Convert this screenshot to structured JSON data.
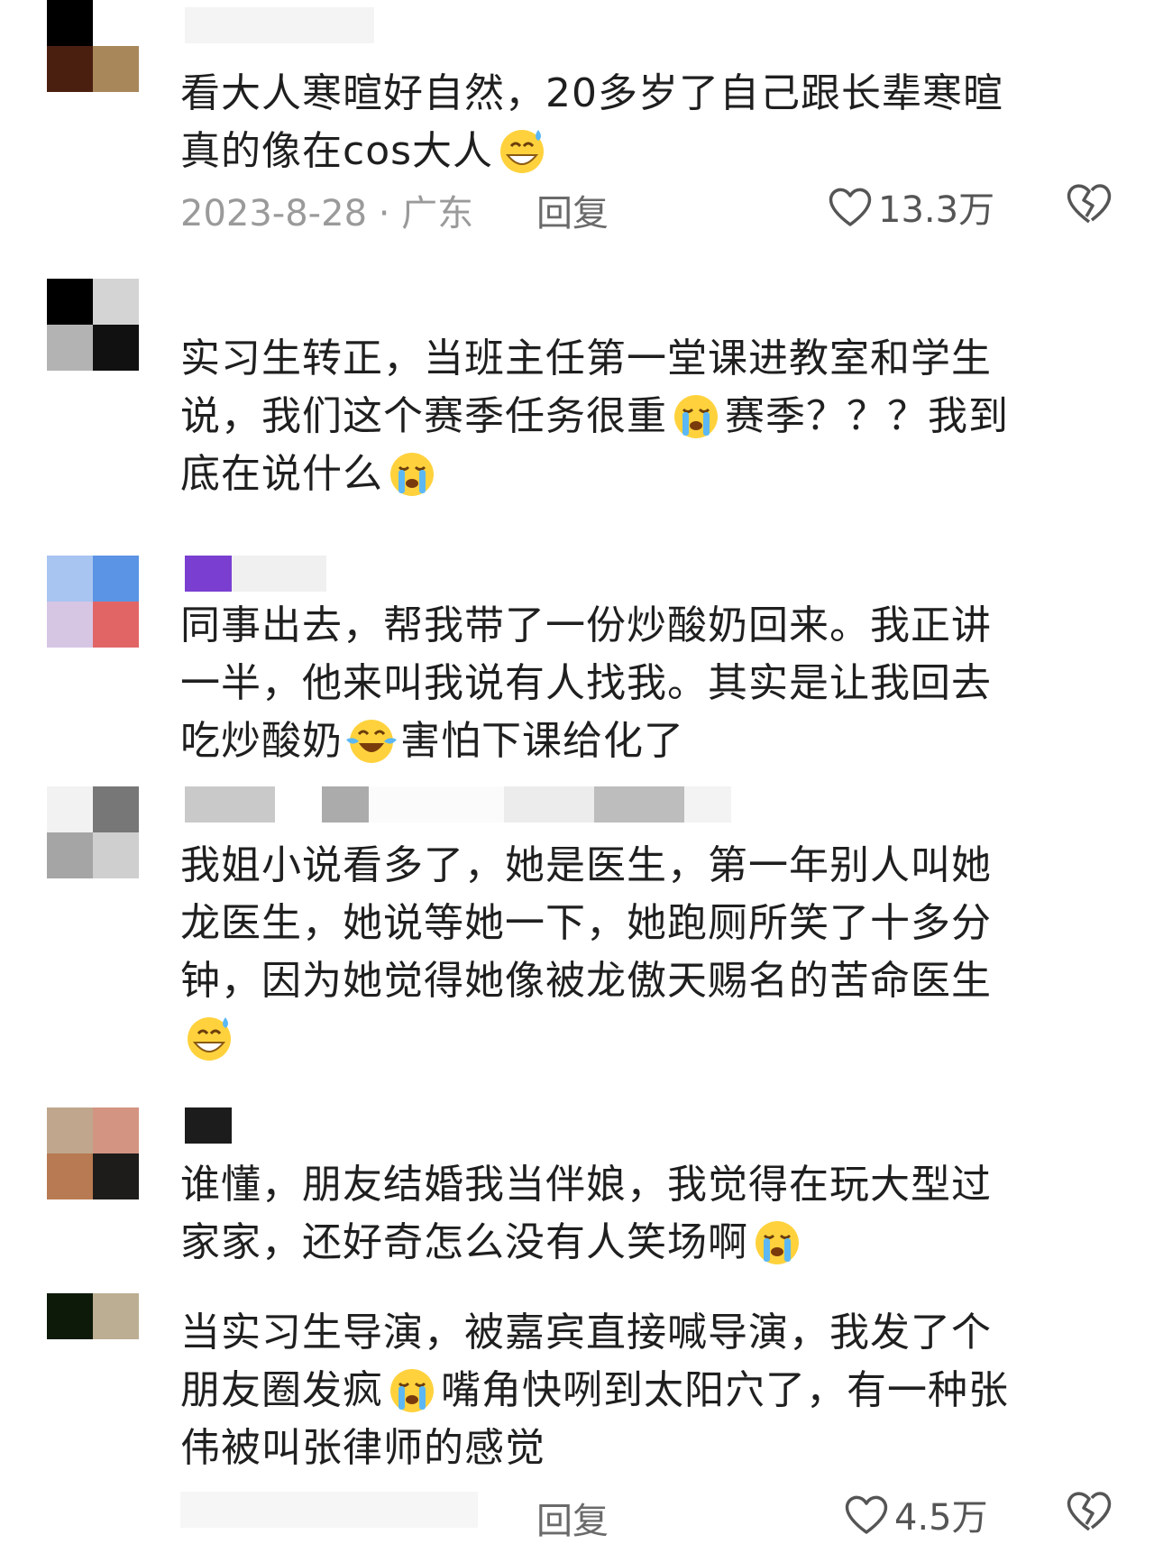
{
  "comments": [
    {
      "avatar_colors": [
        "#000000",
        "#ffffff",
        "#4b1f0f",
        "#a8875b"
      ],
      "lines": [
        "看大人寒暄好自然，20多岁了自己跟长辈寒暄",
        "真的像在cos大人"
      ],
      "emoji": "sweat-smile-emoji",
      "date": "2023-8-28 · 广东",
      "reply": "回复",
      "likes": "13.3万"
    },
    {
      "avatar_colors": [
        "#000000",
        "#d4d4d4",
        "#b3b3b3",
        "#111111"
      ],
      "lines": [
        "实习生转正，当班主任第一堂课进教室和学生",
        "说，我们这个赛季任务很重",
        "赛季？？？我到",
        "底在说什么"
      ],
      "emoji": "crying-emoji"
    },
    {
      "avatar_colors": [
        "#a8c4f0",
        "#5b94e4",
        "#d6c6e4",
        "#e26566"
      ],
      "lines": [
        "同事出去，帮我带了一份炒酸奶回来。我正讲",
        "一半，他来叫我说有人找我。其实是让我回去",
        "吃炒酸奶",
        "害怕下课给化了"
      ],
      "emoji": "laugh-cry-emoji"
    },
    {
      "avatar_colors": [
        "#f2f2f2",
        "#777777",
        "#a5a5a5",
        "#cfcfcf"
      ],
      "lines": [
        "我姐小说看多了，她是医生，第一年别人叫她",
        "龙医生，她说等她一下，她跑厕所笑了十多分",
        "钟，因为她觉得她像被龙傲天赐名的苦命医生"
      ],
      "emoji": "sweat-smile-emoji"
    },
    {
      "avatar_colors": [
        "#bfa68c",
        "#d49482",
        "#b87a52",
        "#1e1c1a"
      ],
      "lines": [
        "谁懂，朋友结婚我当伴娘，我觉得在玩大型过",
        "家家，还好奇怎么没有人笑场啊"
      ],
      "emoji": "crying-emoji"
    },
    {
      "avatar_colors": [
        "#0d1a0a",
        "#bcae93"
      ],
      "lines": [
        "当实习生导演，被嘉宾直接喊导演，我发了个",
        "朋友圈发疯",
        "嘴角快咧到太阳穴了，有一种张",
        "伟被叫张律师的感觉"
      ],
      "emoji": "crying-emoji",
      "reply": "回复",
      "likes": "4.5万"
    }
  ],
  "colors": {
    "text": "#1f1f1f",
    "meta": "#9a9a9a",
    "reply": "#6a6a6a"
  }
}
